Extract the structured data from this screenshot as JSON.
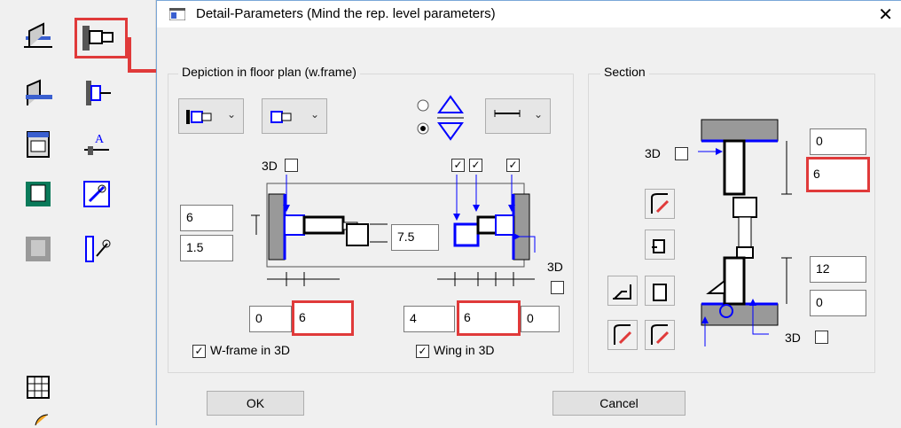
{
  "palette": {
    "items": [
      "wall-window-icon",
      "frame-detail-icon",
      "sill-icon",
      "frame-detail-2-icon",
      "window-elevation-icon",
      "dimension-a-icon",
      "opening-green-icon",
      "macro-edit-icon",
      "disabled-opening-icon",
      "frame-tool-icon",
      "grid-icon"
    ]
  },
  "dialog": {
    "title": "Detail-Parameters (Mind the rep. level parameters)",
    "close_glyph": "✕",
    "floor_plan": {
      "group_label": "Depiction in floor plan (w.frame)",
      "label_3d": "3D",
      "field_left_top": "6",
      "field_left_bottom": "1.5",
      "field_center": "7.5",
      "label_3d_right": "3D",
      "bottom_fields": [
        "0",
        "6",
        "4",
        "6",
        "0"
      ],
      "wframe_label": "W-frame in 3D",
      "wing_label": "Wing in 3D",
      "check_mark": "✓"
    },
    "section": {
      "group_label": "Section",
      "label_3d_top": "3D",
      "field_top_1": "0",
      "field_top_2": "6",
      "field_bottom_1": "12",
      "field_bottom_2": "0",
      "label_3d_bottom": "3D"
    },
    "ok_label": "OK",
    "cancel_label": "Cancel",
    "colors": {
      "highlight": "#e03a3a",
      "accent_blue": "#0000ff",
      "frame_blue": "#7aa7d8"
    }
  }
}
